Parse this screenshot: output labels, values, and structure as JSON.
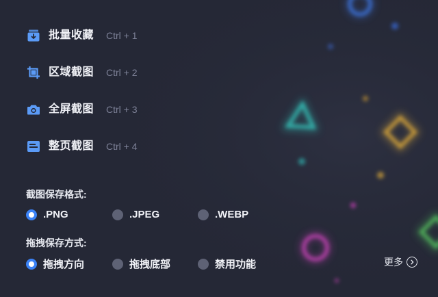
{
  "menu": {
    "items": [
      {
        "label": "批量收藏",
        "shortcut": "Ctrl + 1",
        "icon": "batch-collect-icon"
      },
      {
        "label": "区域截图",
        "shortcut": "Ctrl + 2",
        "icon": "crop-icon"
      },
      {
        "label": "全屏截图",
        "shortcut": "Ctrl + 3",
        "icon": "camera-icon"
      },
      {
        "label": "整页截图",
        "shortcut": "Ctrl + 4",
        "icon": "full-page-icon"
      }
    ]
  },
  "save_format": {
    "title": "截图保存格式:",
    "options": [
      ".PNG",
      ".JPEG",
      ".WEBP"
    ],
    "selected": ".PNG"
  },
  "drag_save": {
    "title": "拖拽保存方式:",
    "options": [
      "拖拽方向",
      "拖拽底部",
      "禁用功能"
    ],
    "selected": "拖拽方向"
  },
  "more": {
    "label": "更多",
    "icon": "chevron-right-circle-icon"
  },
  "colors": {
    "accent": "#3b82f6",
    "background": "#252836",
    "icon": "#5b9bf7"
  }
}
